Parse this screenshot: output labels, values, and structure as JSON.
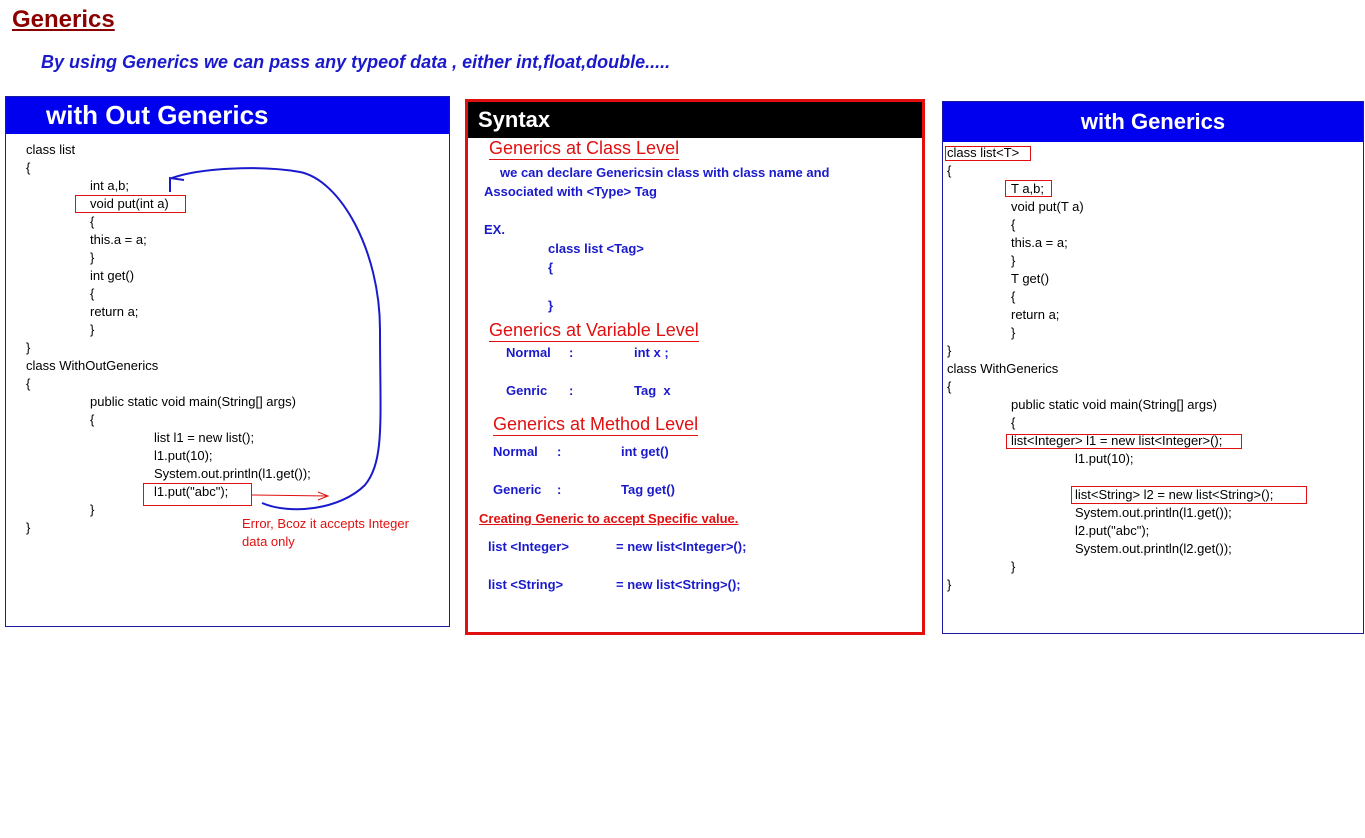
{
  "title": "Generics",
  "intro": "By using Generics we can pass any typeof data , either int,float,double.....",
  "left": {
    "header": "with Out Generics",
    "lines": [
      "class list",
      "{",
      "int a,b;",
      "void put(int a)",
      "{",
      "this.a = a;",
      "}",
      "int get()",
      "{",
      "return a;",
      "}",
      "}",
      "class WithOutGenerics",
      "{",
      "public static void main(String[] args)",
      "{",
      "list l1 = new list();",
      "l1.put(10);",
      "System.out.println(l1.get());",
      "l1.put(\"abc\");",
      "}",
      "}"
    ],
    "error_line1": "Error, Bcoz it accepts Integer",
    "error_line2": "data only"
  },
  "mid": {
    "header": "Syntax",
    "class_level": "Generics at Class Level",
    "class_desc1": "we can declare Genericsin class with class name and",
    "class_desc2": "Associated with <Type> Tag",
    "ex": "EX.",
    "ex_line1": "class list <Tag>",
    "ex_line2": "{",
    "ex_line3": "}",
    "var_level": "Generics at Variable Level",
    "var_normal_label": "Normal",
    "var_normal_colon": ":",
    "var_normal_value": "int x ;",
    "var_generic_label": "Genric",
    "var_generic_colon": ":",
    "var_generic_value": "Tag  x",
    "method_level": "Generics at Method Level",
    "method_normal_label": "Normal",
    "method_normal_colon": ":",
    "method_normal_value": "int get()",
    "method_generic_label": "Generic",
    "method_generic_colon": ":",
    "method_generic_value": "Tag get()",
    "specific": "Creating Generic to accept Specific value.",
    "spec1_left": "list <Integer>",
    "spec1_right": "= new list<Integer>();",
    "spec2_left": "list <String>",
    "spec2_right": "= new list<String>();"
  },
  "right": {
    "header": "with Generics",
    "lines": [
      "class list<T>",
      "{",
      "T a,b;",
      "void put(T a)",
      "{",
      "this.a = a;",
      "}",
      "T get()",
      "{",
      "return a;",
      "}",
      "}",
      "class WithGenerics",
      "{",
      "public static void main(String[] args)",
      "{",
      "list<Integer> l1 = new list<Integer>();",
      "l1.put(10);",
      "list<String> l2 = new list<String>();",
      "System.out.println(l1.get());",
      "l2.put(\"abc\");",
      "System.out.println(l2.get());",
      "}",
      "}"
    ]
  },
  "colors": {
    "title": "#8b0000",
    "blue_header": "#0000ee",
    "syntax_border": "#e01010",
    "blue_text": "#1a1acc",
    "highlight_box": "#e01010"
  },
  "icons": [
    "curved-arrow-icon",
    "error-arrow-icon"
  ]
}
